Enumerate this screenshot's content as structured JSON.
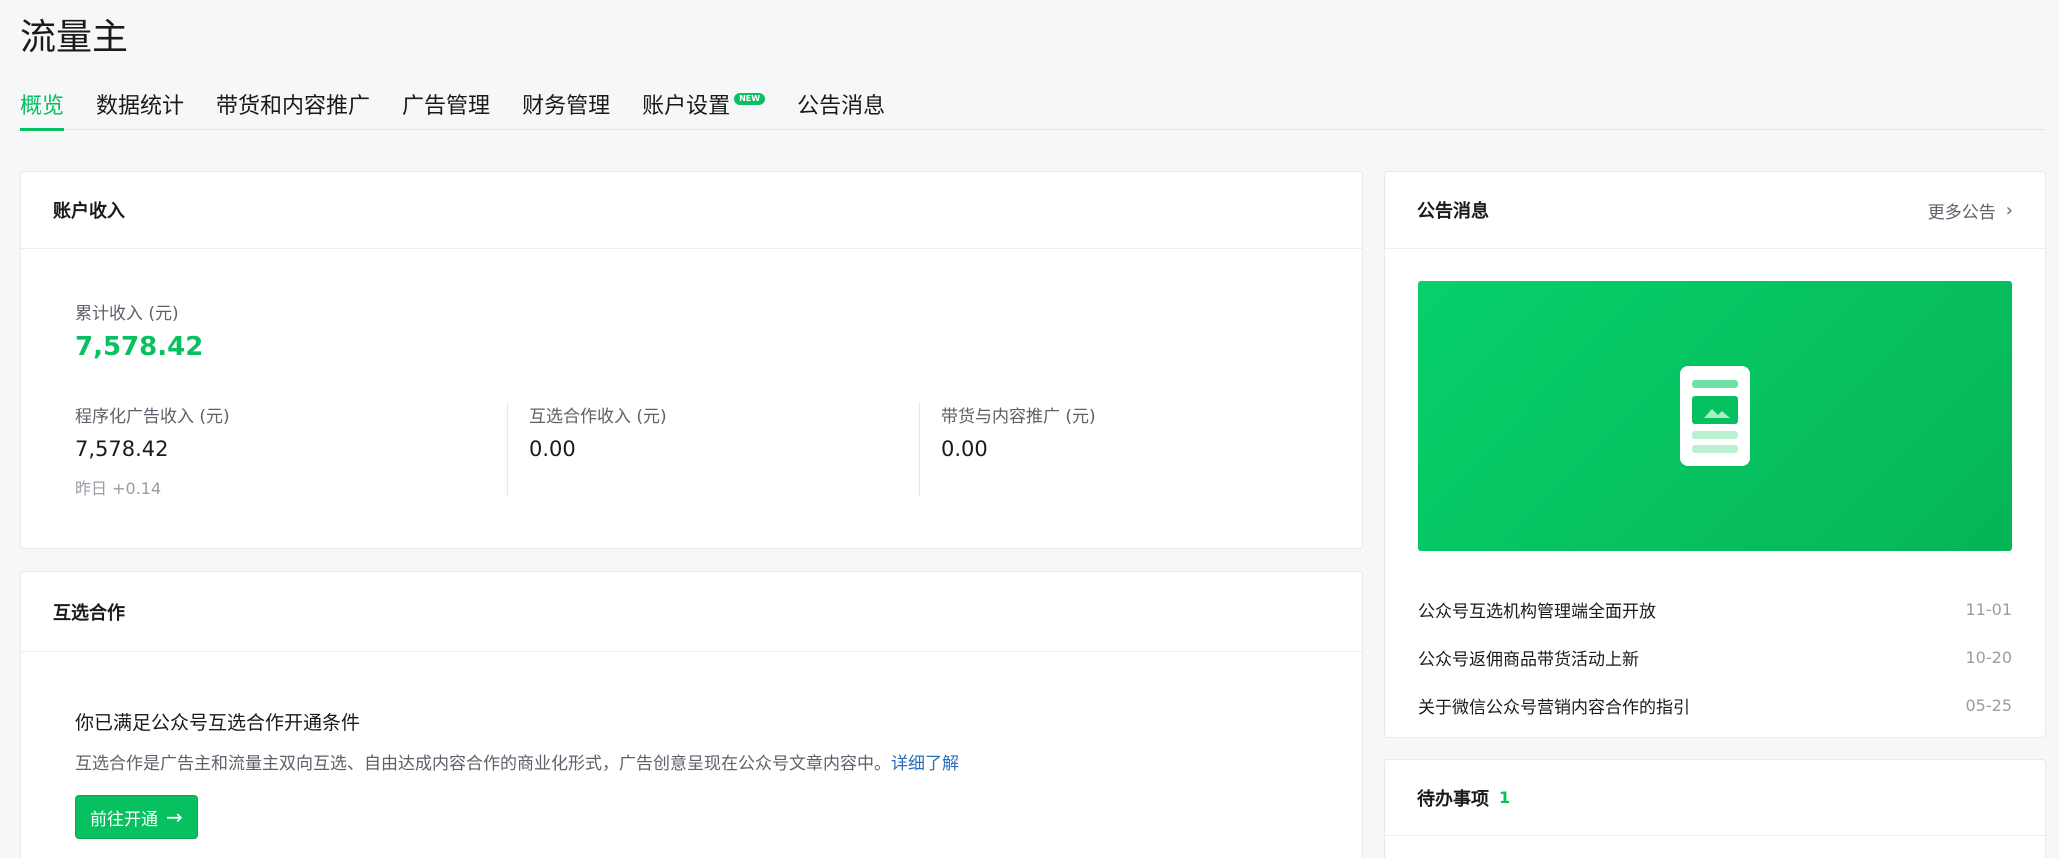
{
  "app": {
    "title": "流量主"
  },
  "tabs": [
    {
      "label": "概览",
      "active": true
    },
    {
      "label": "数据统计"
    },
    {
      "label": "带货和内容推广"
    },
    {
      "label": "广告管理"
    },
    {
      "label": "财务管理"
    },
    {
      "label": "账户设置",
      "badge": "NEW"
    },
    {
      "label": "公告消息"
    }
  ],
  "income": {
    "title": "账户收入",
    "total_label": "累计收入 (元)",
    "total_value": "7,578.42",
    "stats": [
      {
        "label": "程序化广告收入 (元)",
        "value": "7,578.42",
        "sub_label": "昨日",
        "sub_value": "+0.14"
      },
      {
        "label": "互选合作收入 (元)",
        "value": "0.00"
      },
      {
        "label": "带货与内容推广 (元)",
        "value": "0.00"
      }
    ]
  },
  "mutual": {
    "title": "互选合作",
    "headline": "你已满足公众号互选合作开通条件",
    "description": "互选合作是广告主和流量主双向互选、自由达成内容合作的商业化形式，广告创意呈现在公众号文章内容中。",
    "more_link": "详细了解",
    "button_label": "前往开通"
  },
  "announcements": {
    "title": "公告消息",
    "more_label": "更多公告",
    "items": [
      {
        "title": "公众号互选机构管理端全面开放",
        "date": "11-01"
      },
      {
        "title": "公众号返佣商品带货活动上新",
        "date": "10-20"
      },
      {
        "title": "关于微信公众号营销内容合作的指引",
        "date": "05-25"
      }
    ]
  },
  "todo": {
    "title": "待办事项",
    "count": "1"
  },
  "colors": {
    "accent": "#07c160",
    "link": "#2d6fb7"
  }
}
